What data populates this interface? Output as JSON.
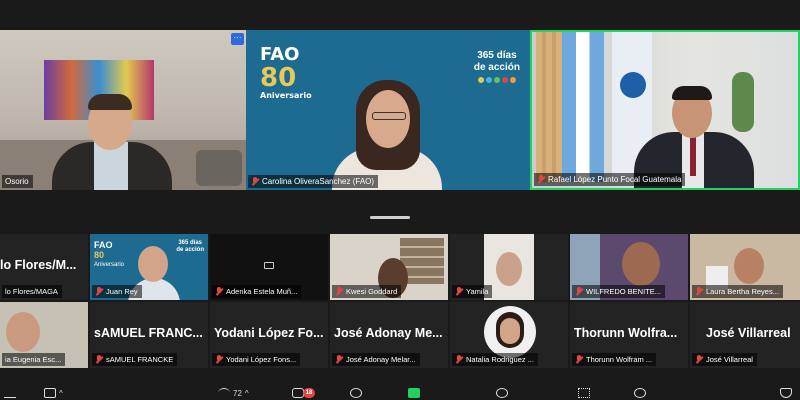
{
  "top_tiles": [
    {
      "name": "Osorio",
      "video": "man in dark jacket at desk"
    },
    {
      "name": "Carolina OliveraSanchez (FAO)",
      "video": "woman with curly hair, FAO background"
    },
    {
      "name": "Rafael López Punto Focal Guatemala",
      "video": "man in suit with flags",
      "active_speaker": true
    }
  ],
  "more_label": "···",
  "fao_background": {
    "brand": "FAO",
    "number": "80",
    "caption": "Aniversario",
    "campaign_line1": "365 días",
    "campaign_line2": "de acción"
  },
  "gallery": {
    "row1": [
      {
        "big_name": "lo Flores/M...",
        "tag": "lo Flores/MAGA",
        "video": false
      },
      {
        "big_name": "",
        "tag": "Juan Rey",
        "video": true,
        "bg_line1": "365 días",
        "bg_line2": "de acción",
        "bg_brand": "FAO",
        "bg_number": "80",
        "bg_caption": "Aniversario"
      },
      {
        "big_name": "",
        "tag": "Adenka Estela Muñ...",
        "video": false,
        "camera_off": true
      },
      {
        "big_name": "",
        "tag": "Kwesi Goddard",
        "video": true
      },
      {
        "big_name": "",
        "tag": "Yamila",
        "video": true
      },
      {
        "big_name": "",
        "tag": "WILFREDO BENITE...",
        "video": true
      },
      {
        "big_name": "",
        "tag": "Laura Bertha Reyes...",
        "video": true
      }
    ],
    "row2": [
      {
        "big_name": "",
        "tag": "ia Eugenia Esc...",
        "video": true
      },
      {
        "big_name": "sAMUEL FRANC...",
        "tag": "sAMUEL FRANCKE",
        "video": false
      },
      {
        "big_name": "Yodani López Fo...",
        "tag": "Yodani López Fons...",
        "video": false
      },
      {
        "big_name": "José Adonay Me...",
        "tag": "José Adonay Melar...",
        "video": false
      },
      {
        "big_name": "",
        "tag": "Natalia Rodriguez ...",
        "video": true
      },
      {
        "big_name": "Thorunn Wolfra...",
        "tag": "Thorunn Wolfram ...",
        "video": false
      },
      {
        "big_name": "José Villarreal",
        "tag": "José Villarreal",
        "video": false
      }
    ]
  },
  "toolbar": {
    "participants_count": "72",
    "chat_badge": "18"
  },
  "colors": {
    "active_speaker_border": "#23d160",
    "mute_red": "#e0463f",
    "fao_blue": "#1e6b91",
    "more_button_blue": "#2d6bdc"
  },
  "icons": [
    "mic-off-icon",
    "camera-off-icon",
    "microphone-icon",
    "video-icon",
    "participants-icon",
    "chat-icon",
    "reactions-icon",
    "share-screen-icon",
    "info-icon",
    "apps-icon",
    "more-icon",
    "security-icon"
  ]
}
